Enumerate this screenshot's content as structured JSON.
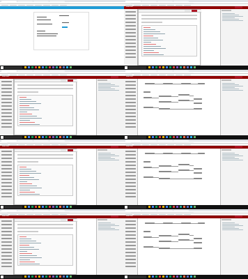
{
  "screens": [
    {
      "kind": "login",
      "header": "Node-RED"
    },
    {
      "kind": "dialog",
      "header": "Node-RED"
    },
    {
      "kind": "editor",
      "header": "Node-RED"
    },
    {
      "kind": "flow",
      "header": "Node-RED"
    },
    {
      "kind": "editor",
      "header": "Node-RED"
    },
    {
      "kind": "flow",
      "header": "Node-RED"
    },
    {
      "kind": "editor",
      "header": "Node-RED"
    },
    {
      "kind": "flow",
      "header": "Node-RED"
    }
  ],
  "colors": {
    "header": "#8f0000",
    "deploy": "#ad1625",
    "function_node": "#fdd0a2",
    "inject_node": "#a6bbcf",
    "debug_node": "#87a980",
    "http_node": "#e7e7ae",
    "blue_node": "#3f93cf",
    "teal_node": "#8ad5d2",
    "taskbar": "#101010"
  }
}
